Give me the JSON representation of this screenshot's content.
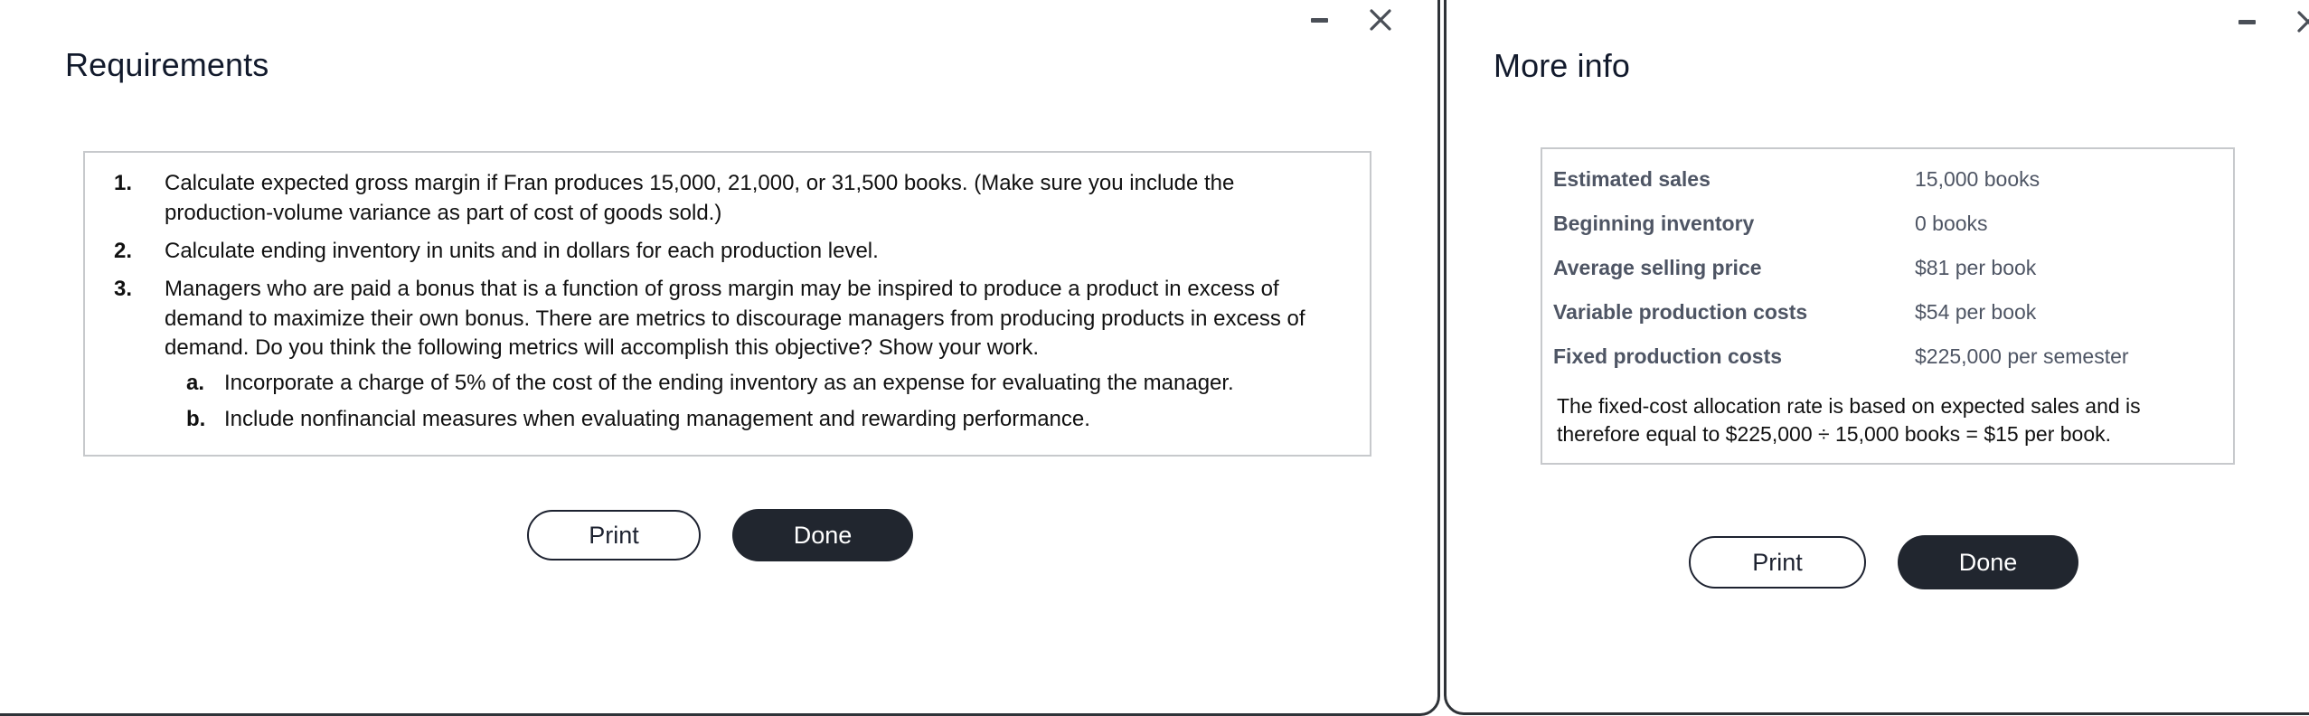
{
  "panels": {
    "requirements": {
      "title": "Requirements",
      "window_controls": {
        "minimize_name": "minimize-icon",
        "close_name": "close-icon"
      },
      "items": [
        {
          "marker": "1.",
          "text": "Calculate expected gross margin if Fran produces 15,000, 21,000, or 31,500 books. (Make sure you include the production-volume variance as part of cost of goods sold.)"
        },
        {
          "marker": "2.",
          "text": "Calculate ending inventory in units and in dollars for each production level."
        },
        {
          "marker": "3.",
          "text": "Managers who are paid a bonus that is a function of gross margin may be inspired to produce a product in excess of demand to maximize their own bonus. There are metrics to discourage managers from producing products in excess of demand. Do you think the following metrics will accomplish this objective? Show your work.",
          "sub_items": [
            {
              "marker": "a.",
              "text": "Incorporate a charge of 5% of the cost of the ending inventory as an expense for evaluating the manager."
            },
            {
              "marker": "b.",
              "text": "Include nonfinancial measures when evaluating management and rewarding performance."
            }
          ]
        }
      ],
      "buttons": {
        "print": "Print",
        "done": "Done"
      }
    },
    "more_info": {
      "title": "More info",
      "window_controls": {
        "minimize_name": "minimize-icon",
        "close_name": "close-icon"
      },
      "rows": [
        {
          "label": "Estimated sales",
          "value": "15,000 books"
        },
        {
          "label": "Beginning inventory",
          "value": "0 books"
        },
        {
          "label": "Average selling price",
          "value": "$81 per book"
        },
        {
          "label": "Variable production costs",
          "value": "$54 per book"
        },
        {
          "label": "Fixed production costs",
          "value": "$225,000 per semester"
        }
      ],
      "note": "The fixed-cost allocation rate is based on expected sales and is therefore equal to $225,000 ÷ 15,000 books = $15 per book.",
      "buttons": {
        "print": "Print",
        "done": "Done"
      }
    }
  },
  "colors": {
    "panel_border": "#2f3338",
    "title_text": "#121a2c",
    "box_border": "#c7c9cc",
    "label_text": "#4e5564",
    "primary_button_bg": "#21262f",
    "control_icon": "#4a4f57"
  }
}
